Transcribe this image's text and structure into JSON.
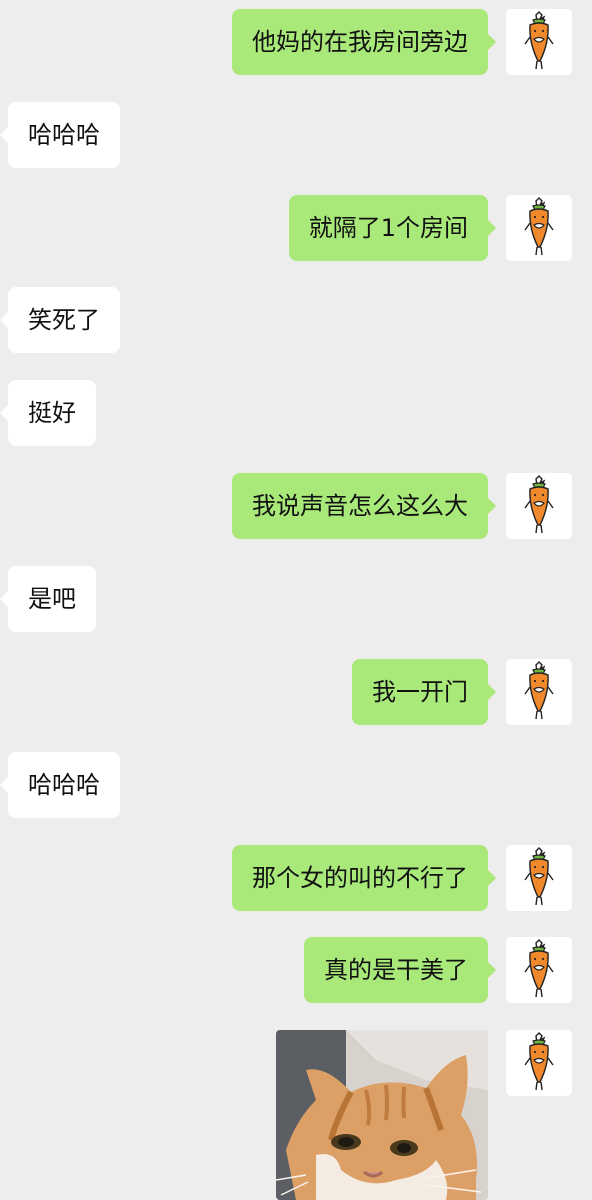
{
  "chat": {
    "messages": [
      {
        "side": "out",
        "type": "text",
        "text": "他妈的在我房间旁边"
      },
      {
        "side": "in",
        "type": "text",
        "text": "哈哈哈"
      },
      {
        "side": "out",
        "type": "text",
        "text": "就隔了1个房间"
      },
      {
        "side": "in",
        "type": "text",
        "text": "笑死了"
      },
      {
        "side": "in",
        "type": "text",
        "text": "挺好"
      },
      {
        "side": "out",
        "type": "text",
        "text": "我说声音怎么这么大"
      },
      {
        "side": "in",
        "type": "text",
        "text": "是吧"
      },
      {
        "side": "out",
        "type": "text",
        "text": "我一开门"
      },
      {
        "side": "in",
        "type": "text",
        "text": "哈哈哈"
      },
      {
        "side": "out",
        "type": "text",
        "text": "那个女的叫的不行了"
      },
      {
        "side": "out",
        "type": "text",
        "text": "真的是干美了"
      },
      {
        "side": "out",
        "type": "image",
        "image": "cat-sticker"
      }
    ],
    "avatar_icon": "carrot-avatar-icon"
  },
  "colors": {
    "background": "#ededed",
    "outgoing_bubble": "#a9e97a",
    "incoming_bubble": "#ffffff",
    "text": "#111111"
  }
}
